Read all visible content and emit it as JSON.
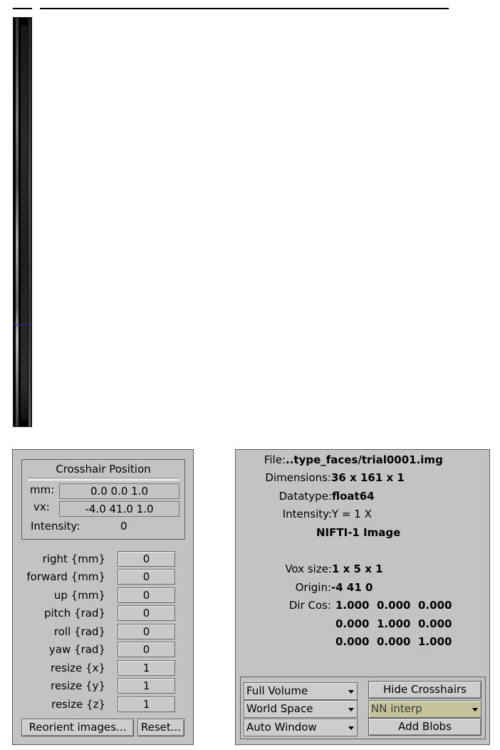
{
  "viewer": {
    "crosshair_color": "#1f2fb0"
  },
  "crosshair": {
    "title": "Crosshair Position",
    "mm_label": "mm:",
    "mm_value": "0.0 0.0 1.0",
    "vx_label": "vx:",
    "vx_value": "-4.0 41.0 1.0",
    "intensity_label": "Intensity:",
    "intensity_value": "0"
  },
  "transform": [
    {
      "label": "right  {mm}",
      "value": "0"
    },
    {
      "label": "forward  {mm}",
      "value": "0"
    },
    {
      "label": "up  {mm}",
      "value": "0"
    },
    {
      "label": "pitch  {rad}",
      "value": "0"
    },
    {
      "label": "roll  {rad}",
      "value": "0"
    },
    {
      "label": "yaw  {rad}",
      "value": "0"
    },
    {
      "label": "resize  {x}",
      "value": "1"
    },
    {
      "label": "resize  {y}",
      "value": "1"
    },
    {
      "label": "resize  {z}",
      "value": "1"
    }
  ],
  "buttons": {
    "reorient": "Reorient images...",
    "reset": "Reset..."
  },
  "info": {
    "file_label": "File:",
    "file_value": "..type_faces/trial0001.img",
    "dimensions_label": "Dimensions:",
    "dimensions_value": "36 x 161 x 1",
    "datatype_label": "Datatype:",
    "datatype_value": "float64",
    "intensity_label": "Intensity:",
    "intensity_value": "Y = 1 X",
    "format": "NIFTI-1 Image",
    "voxsize_label": "Vox size:",
    "voxsize_value": "1 x 5 x 1",
    "origin_label": "Origin:",
    "origin_value": "-4 41 0",
    "dircos_label": "Dir Cos:",
    "dircos": [
      [
        "1.000",
        "0.000",
        "0.000"
      ],
      [
        "0.000",
        "1.000",
        "0.000"
      ],
      [
        "0.000",
        "0.000",
        "1.000"
      ]
    ]
  },
  "controls": {
    "volume_select": "Full Volume",
    "space_select": "World Space",
    "window_select": "Auto Window",
    "hide_crosshairs": "Hide Crosshairs",
    "interp_select": "NN interp",
    "add_blobs": "Add Blobs"
  }
}
